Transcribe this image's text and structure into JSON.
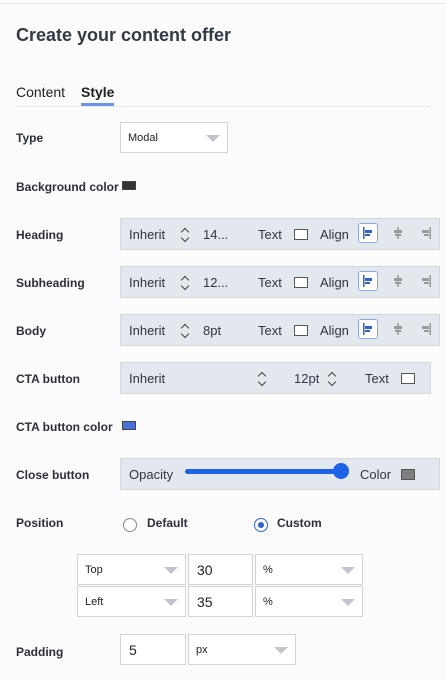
{
  "title": "Create your content offer",
  "tabs": [
    {
      "label": "Content",
      "active": false
    },
    {
      "label": "Style",
      "active": true
    }
  ],
  "type": {
    "label": "Type",
    "value": "Modal"
  },
  "background_color": {
    "label": "Background color",
    "color": "#333333"
  },
  "heading": {
    "label": "Heading",
    "font": "Inherit",
    "size": "14...",
    "text_label": "Text",
    "align_label": "Align"
  },
  "subheading": {
    "label": "Subheading",
    "font": "Inherit",
    "size": "12...",
    "text_label": "Text",
    "align_label": "Align"
  },
  "body": {
    "label": "Body",
    "font": "Inherit",
    "size": "8pt",
    "text_label": "Text",
    "align_label": "Align"
  },
  "cta_button": {
    "label": "CTA button",
    "font": "Inherit",
    "size": "12pt",
    "text_label": "Text"
  },
  "cta_button_color": {
    "label": "CTA button color",
    "color": "#4a6fd6"
  },
  "close_button": {
    "label": "Close button",
    "opacity_label": "Opacity",
    "opacity_value": 1.0,
    "color_label": "Color",
    "color": "#808080"
  },
  "position": {
    "label": "Position",
    "options": [
      {
        "label": "Default",
        "selected": false
      },
      {
        "label": "Custom",
        "selected": true
      }
    ],
    "rows": [
      {
        "side": "Top",
        "value": "30",
        "unit": "%"
      },
      {
        "side": "Left",
        "value": "35",
        "unit": "%"
      }
    ]
  },
  "padding": {
    "label": "Padding",
    "value": "5",
    "unit": "px"
  },
  "colors": {
    "accent": "#1d63e6",
    "tab_underline": "#6a95e8",
    "bar_bg": "#e3e8ef"
  }
}
